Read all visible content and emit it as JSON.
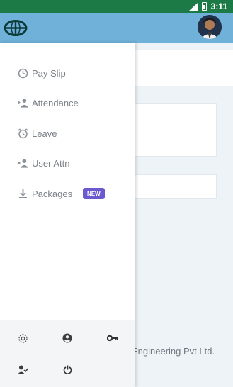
{
  "status": {
    "time": "3:11"
  },
  "appbar": {
    "logo_icon": "globe-logo-icon",
    "avatar_icon": "user-avatar"
  },
  "menu": [
    {
      "label": "Pay Slip",
      "icon": "clock-icon"
    },
    {
      "label": "Attendance",
      "icon": "user-add-icon"
    },
    {
      "label": "Leave",
      "icon": "alarm-icon"
    },
    {
      "label": "User Attn",
      "icon": "user-add-icon"
    },
    {
      "label": "Packages",
      "icon": "download-icon",
      "badge": "NEW"
    }
  ],
  "background": {
    "footer_text": "Engineering Pvt Ltd."
  },
  "drawer_footer": {
    "icons": [
      "settings-icon",
      "profile-icon",
      "key-icon",
      "user-check-icon",
      "power-icon"
    ]
  },
  "colors": {
    "status_bar": "#1b7a46",
    "app_bar": "#6fb1d9",
    "badge": "#6a5acd"
  }
}
